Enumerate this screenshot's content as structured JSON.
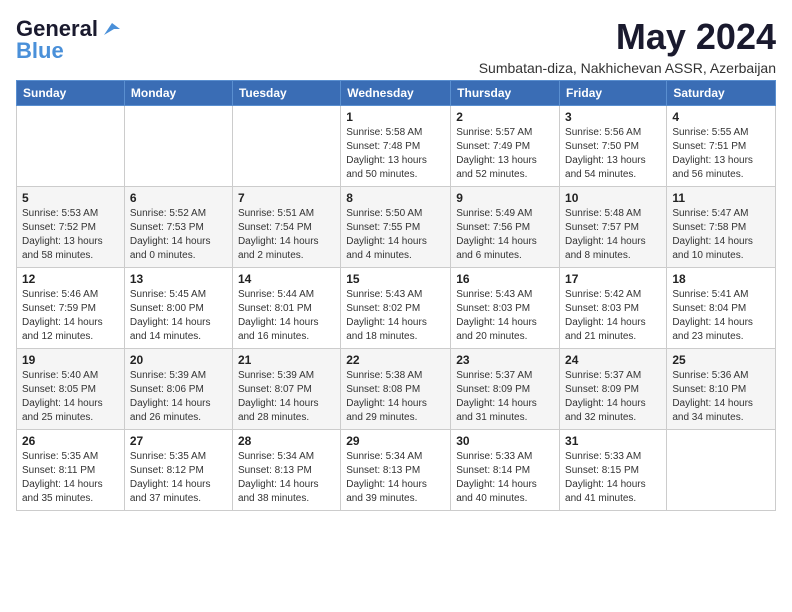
{
  "logo": {
    "line1": "General",
    "line2": "Blue"
  },
  "title": "May 2024",
  "subtitle": "Sumbatan-diza, Nakhichevan ASSR, Azerbaijan",
  "days_of_week": [
    "Sunday",
    "Monday",
    "Tuesday",
    "Wednesday",
    "Thursday",
    "Friday",
    "Saturday"
  ],
  "weeks": [
    [
      {
        "day": "",
        "info": ""
      },
      {
        "day": "",
        "info": ""
      },
      {
        "day": "",
        "info": ""
      },
      {
        "day": "1",
        "info": "Sunrise: 5:58 AM\nSunset: 7:48 PM\nDaylight: 13 hours\nand 50 minutes."
      },
      {
        "day": "2",
        "info": "Sunrise: 5:57 AM\nSunset: 7:49 PM\nDaylight: 13 hours\nand 52 minutes."
      },
      {
        "day": "3",
        "info": "Sunrise: 5:56 AM\nSunset: 7:50 PM\nDaylight: 13 hours\nand 54 minutes."
      },
      {
        "day": "4",
        "info": "Sunrise: 5:55 AM\nSunset: 7:51 PM\nDaylight: 13 hours\nand 56 minutes."
      }
    ],
    [
      {
        "day": "5",
        "info": "Sunrise: 5:53 AM\nSunset: 7:52 PM\nDaylight: 13 hours\nand 58 minutes."
      },
      {
        "day": "6",
        "info": "Sunrise: 5:52 AM\nSunset: 7:53 PM\nDaylight: 14 hours\nand 0 minutes."
      },
      {
        "day": "7",
        "info": "Sunrise: 5:51 AM\nSunset: 7:54 PM\nDaylight: 14 hours\nand 2 minutes."
      },
      {
        "day": "8",
        "info": "Sunrise: 5:50 AM\nSunset: 7:55 PM\nDaylight: 14 hours\nand 4 minutes."
      },
      {
        "day": "9",
        "info": "Sunrise: 5:49 AM\nSunset: 7:56 PM\nDaylight: 14 hours\nand 6 minutes."
      },
      {
        "day": "10",
        "info": "Sunrise: 5:48 AM\nSunset: 7:57 PM\nDaylight: 14 hours\nand 8 minutes."
      },
      {
        "day": "11",
        "info": "Sunrise: 5:47 AM\nSunset: 7:58 PM\nDaylight: 14 hours\nand 10 minutes."
      }
    ],
    [
      {
        "day": "12",
        "info": "Sunrise: 5:46 AM\nSunset: 7:59 PM\nDaylight: 14 hours\nand 12 minutes."
      },
      {
        "day": "13",
        "info": "Sunrise: 5:45 AM\nSunset: 8:00 PM\nDaylight: 14 hours\nand 14 minutes."
      },
      {
        "day": "14",
        "info": "Sunrise: 5:44 AM\nSunset: 8:01 PM\nDaylight: 14 hours\nand 16 minutes."
      },
      {
        "day": "15",
        "info": "Sunrise: 5:43 AM\nSunset: 8:02 PM\nDaylight: 14 hours\nand 18 minutes."
      },
      {
        "day": "16",
        "info": "Sunrise: 5:43 AM\nSunset: 8:03 PM\nDaylight: 14 hours\nand 20 minutes."
      },
      {
        "day": "17",
        "info": "Sunrise: 5:42 AM\nSunset: 8:03 PM\nDaylight: 14 hours\nand 21 minutes."
      },
      {
        "day": "18",
        "info": "Sunrise: 5:41 AM\nSunset: 8:04 PM\nDaylight: 14 hours\nand 23 minutes."
      }
    ],
    [
      {
        "day": "19",
        "info": "Sunrise: 5:40 AM\nSunset: 8:05 PM\nDaylight: 14 hours\nand 25 minutes."
      },
      {
        "day": "20",
        "info": "Sunrise: 5:39 AM\nSunset: 8:06 PM\nDaylight: 14 hours\nand 26 minutes."
      },
      {
        "day": "21",
        "info": "Sunrise: 5:39 AM\nSunset: 8:07 PM\nDaylight: 14 hours\nand 28 minutes."
      },
      {
        "day": "22",
        "info": "Sunrise: 5:38 AM\nSunset: 8:08 PM\nDaylight: 14 hours\nand 29 minutes."
      },
      {
        "day": "23",
        "info": "Sunrise: 5:37 AM\nSunset: 8:09 PM\nDaylight: 14 hours\nand 31 minutes."
      },
      {
        "day": "24",
        "info": "Sunrise: 5:37 AM\nSunset: 8:09 PM\nDaylight: 14 hours\nand 32 minutes."
      },
      {
        "day": "25",
        "info": "Sunrise: 5:36 AM\nSunset: 8:10 PM\nDaylight: 14 hours\nand 34 minutes."
      }
    ],
    [
      {
        "day": "26",
        "info": "Sunrise: 5:35 AM\nSunset: 8:11 PM\nDaylight: 14 hours\nand 35 minutes."
      },
      {
        "day": "27",
        "info": "Sunrise: 5:35 AM\nSunset: 8:12 PM\nDaylight: 14 hours\nand 37 minutes."
      },
      {
        "day": "28",
        "info": "Sunrise: 5:34 AM\nSunset: 8:13 PM\nDaylight: 14 hours\nand 38 minutes."
      },
      {
        "day": "29",
        "info": "Sunrise: 5:34 AM\nSunset: 8:13 PM\nDaylight: 14 hours\nand 39 minutes."
      },
      {
        "day": "30",
        "info": "Sunrise: 5:33 AM\nSunset: 8:14 PM\nDaylight: 14 hours\nand 40 minutes."
      },
      {
        "day": "31",
        "info": "Sunrise: 5:33 AM\nSunset: 8:15 PM\nDaylight: 14 hours\nand 41 minutes."
      },
      {
        "day": "",
        "info": ""
      }
    ]
  ]
}
